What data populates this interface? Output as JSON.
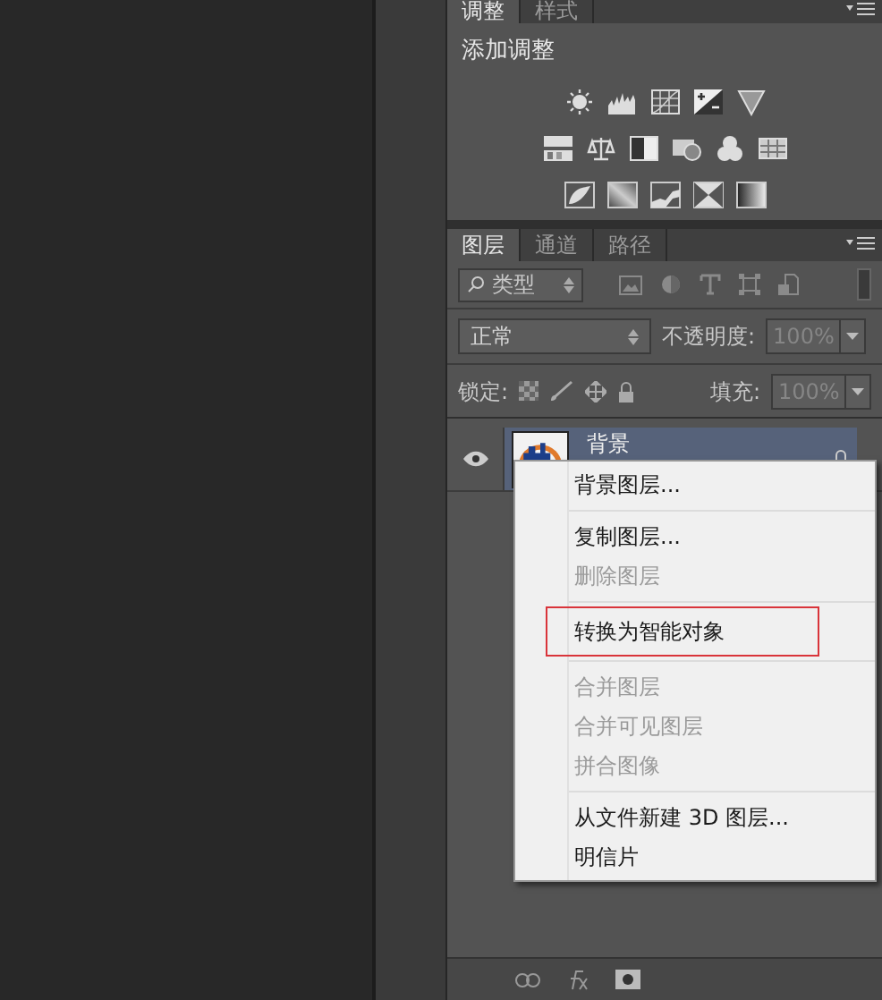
{
  "adjustments_panel": {
    "tabs": [
      {
        "label": "调整",
        "selected": true
      },
      {
        "label": "样式",
        "selected": false
      }
    ],
    "heading": "添加调整"
  },
  "layers_panel": {
    "tabs": [
      {
        "label": "图层",
        "selected": true
      },
      {
        "label": "通道",
        "selected": false
      },
      {
        "label": "路径",
        "selected": false
      }
    ],
    "filter": {
      "value": "类型"
    },
    "blend_mode": {
      "value": "正常"
    },
    "opacity": {
      "label": "不透明度:",
      "value": "100%",
      "disabled": true
    },
    "lock": {
      "label": "锁定:"
    },
    "fill": {
      "label": "填充:",
      "value": "100%",
      "disabled": true
    },
    "layers": [
      {
        "name": "背景",
        "selected": true,
        "visible": true,
        "locked": true
      }
    ]
  },
  "context_menu": {
    "groups": [
      [
        {
          "label": "背景图层...",
          "disabled": false,
          "outlined": false
        }
      ],
      [
        {
          "label": "复制图层...",
          "disabled": false,
          "outlined": false
        },
        {
          "label": "删除图层",
          "disabled": true,
          "outlined": false
        }
      ],
      [
        {
          "label": "转换为智能对象",
          "disabled": false,
          "outlined": true
        }
      ],
      [
        {
          "label": "合并图层",
          "disabled": true,
          "outlined": false
        },
        {
          "label": "合并可见图层",
          "disabled": true,
          "outlined": false
        },
        {
          "label": "拼合图像",
          "disabled": true,
          "outlined": false
        }
      ],
      [
        {
          "label": "从文件新建 3D 图层...",
          "disabled": false,
          "outlined": false
        },
        {
          "label": "明信片",
          "disabled": false,
          "outlined": false
        }
      ]
    ]
  }
}
